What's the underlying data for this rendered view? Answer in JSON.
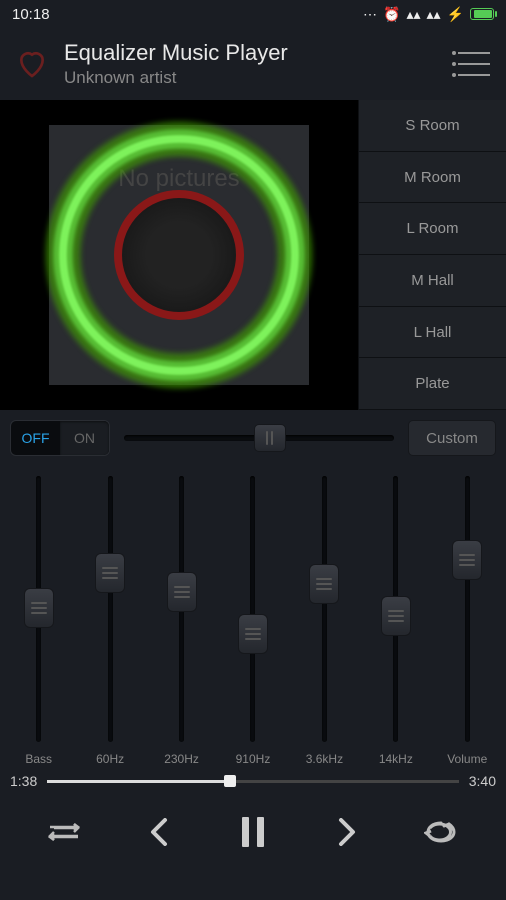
{
  "status": {
    "time": "10:18"
  },
  "header": {
    "title": "Equalizer Music Player",
    "subtitle": "Unknown artist"
  },
  "artwork": {
    "placeholder": "No pictures"
  },
  "presets": {
    "items": [
      "S Room",
      "M Room",
      "L Room",
      "M Hall",
      "L Hall",
      "Plate"
    ]
  },
  "toggle": {
    "off": "OFF",
    "on": "ON"
  },
  "custom_label": "Custom",
  "eq": {
    "bands": [
      {
        "label": "Bass",
        "pos": 42
      },
      {
        "label": "60Hz",
        "pos": 29
      },
      {
        "label": "230Hz",
        "pos": 36
      },
      {
        "label": "910Hz",
        "pos": 52
      },
      {
        "label": "3.6kHz",
        "pos": 33
      },
      {
        "label": "14kHz",
        "pos": 45
      },
      {
        "label": "Volume",
        "pos": 24
      }
    ]
  },
  "progress": {
    "current": "1:38",
    "total": "3:40",
    "percent": 44.5
  }
}
